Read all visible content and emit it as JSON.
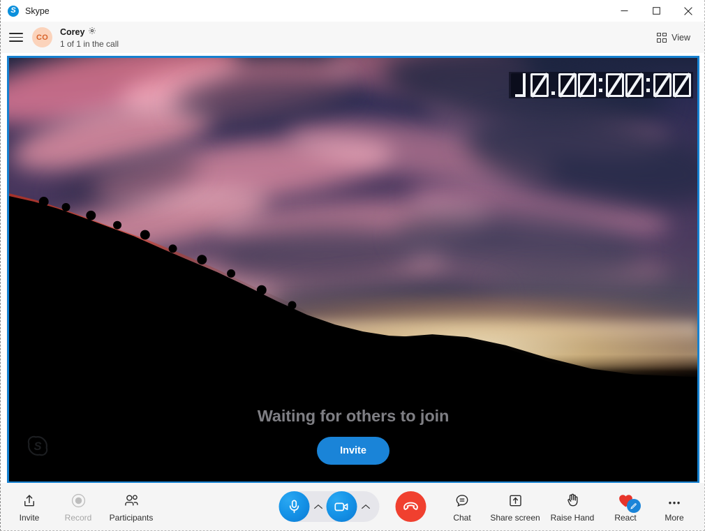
{
  "window": {
    "app_title": "Skype",
    "logo_letter": "S",
    "controls": {
      "minimize": "minimize-button",
      "maximize": "maximize-button",
      "close": "close-button"
    }
  },
  "header": {
    "menu_icon": "hamburger-menu-icon",
    "avatar_initials": "CO",
    "call_name": "Corey",
    "settings_icon": "gear-icon",
    "participant_status": "1 of 1 in the call",
    "view_label": "View",
    "view_icon": "grid-view-icon"
  },
  "stage": {
    "border_color": "#1681d0",
    "timer": {
      "display": "01.00:00:00",
      "digits": [
        "1",
        "0",
        ".",
        "0",
        "0",
        ":",
        "0",
        "0",
        ":",
        "0",
        "0"
      ]
    },
    "watermark_icon": "skype-logo-watermark",
    "waiting_text": "Waiting for others to join",
    "invite_button": "Invite",
    "invite_color": "#1a84d8"
  },
  "toolbar": {
    "left_items": [
      {
        "label": "Invite",
        "icon": "share-upload-icon",
        "disabled": false
      },
      {
        "label": "Record",
        "icon": "record-circle-icon",
        "disabled": true
      },
      {
        "label": "Participants",
        "icon": "people-icon",
        "disabled": false
      }
    ],
    "center": {
      "mic": {
        "name": "microphone-button",
        "icon": "microphone-icon",
        "state": "on"
      },
      "mic_menu": {
        "name": "microphone-options",
        "icon": "chevron-up-icon"
      },
      "camera": {
        "name": "camera-button",
        "icon": "video-camera-icon",
        "state": "on"
      },
      "camera_menu": {
        "name": "camera-options",
        "icon": "chevron-up-icon"
      },
      "end_call": {
        "name": "end-call-button",
        "icon": "hangup-phone-icon",
        "color": "#f0402f"
      }
    },
    "right_items": [
      {
        "label": "Chat",
        "icon": "chat-bubble-icon"
      },
      {
        "label": "Share screen",
        "icon": "share-screen-icon"
      },
      {
        "label": "Raise Hand",
        "icon": "raised-hand-icon"
      },
      {
        "label": "React",
        "icon": "heart-icon",
        "badge_icon": "pencil-badge-icon"
      },
      {
        "label": "More",
        "icon": "ellipsis-icon"
      }
    ]
  }
}
